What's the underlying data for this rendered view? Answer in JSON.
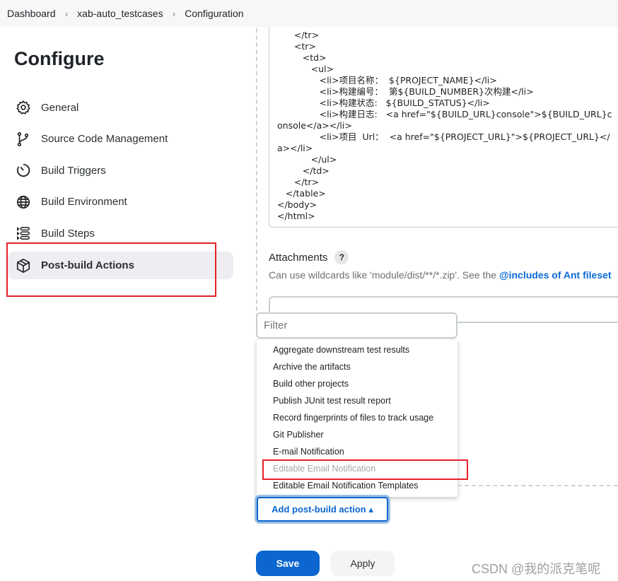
{
  "breadcrumb": [
    "Dashboard",
    "xab-auto_testcases",
    "Configuration"
  ],
  "page_title": "Configure",
  "sidebar": {
    "items": [
      {
        "label": "General",
        "icon": "gear-icon"
      },
      {
        "label": "Source Code Management",
        "icon": "branch-icon"
      },
      {
        "label": "Build Triggers",
        "icon": "timer-icon"
      },
      {
        "label": "Build Environment",
        "icon": "globe-icon"
      },
      {
        "label": "Build Steps",
        "icon": "list-icon"
      },
      {
        "label": "Post-build Actions",
        "icon": "package-icon",
        "active": true
      }
    ]
  },
  "code_lines": [
    "      </tr>",
    "      <tr>",
    "         <td>",
    "            <ul>",
    "               <li>项目名称：  ${PROJECT_NAME}</li>",
    "               <li>构建编号：  第${BUILD_NUMBER}次构建</li>",
    "               <li>构建状态:   ${BUILD_STATUS}</li>",
    "               <li>构建日志:   <a href=\"${BUILD_URL}console\">${BUILD_URL}console</a></li>",
    "               <li>项目  Url：  <a href=\"${PROJECT_URL}\">${PROJECT_URL}</a></li>",
    "            </ul>",
    "         </td>",
    "      </tr>",
    "   </table>",
    "</body>",
    "</html>"
  ],
  "attachments": {
    "label": "Attachments",
    "help": "?",
    "hint": "Can use wildcards like 'module/dist/**/*.zip'. See the ",
    "hint_link": "@includes of Ant fileset",
    "value": ""
  },
  "filter": {
    "placeholder": "Filter",
    "value": ""
  },
  "menu": {
    "items": [
      {
        "label": "Aggregate downstream test results"
      },
      {
        "label": "Archive the artifacts"
      },
      {
        "label": "Build other projects"
      },
      {
        "label": "Publish JUnit test result report"
      },
      {
        "label": "Record fingerprints of files to track usage"
      },
      {
        "label": "Git Publisher"
      },
      {
        "label": "E-mail Notification"
      },
      {
        "label": "Editable Email Notification",
        "disabled": true
      },
      {
        "label": "Editable Email Notification Templates"
      }
    ]
  },
  "add_action_label": "Add post-build action ▴",
  "save_label": "Save",
  "apply_label": "Apply",
  "watermark": "CSDN @我的派克笔呢",
  "colors": {
    "accent": "#0b66cf",
    "highlight": "#e8202a"
  }
}
